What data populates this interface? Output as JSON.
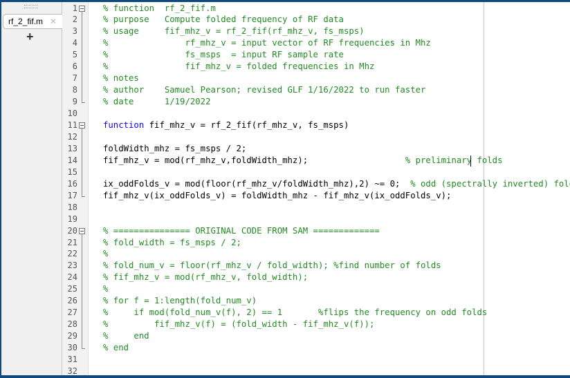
{
  "file_panel": {
    "tabs": [
      {
        "label": "rf_2_fif.m",
        "close_icon": "close-icon"
      }
    ],
    "add_tab_label": "+"
  },
  "editor": {
    "lines": [
      {
        "n": "1",
        "segments": [
          {
            "t": "% function  rf_2_fif.m",
            "c": "cmt"
          }
        ]
      },
      {
        "n": "2",
        "segments": [
          {
            "t": "% purpose   Compute folded frequency of RF data",
            "c": "cmt"
          }
        ]
      },
      {
        "n": "3",
        "segments": [
          {
            "t": "% usage     fif_mhz_v = rf_2_fif(rf_mhz_v, fs_msps)",
            "c": "cmt"
          }
        ]
      },
      {
        "n": "4",
        "segments": [
          {
            "t": "%               rf_mhz_v = input vector of RF frequencies in Mhz",
            "c": "cmt"
          }
        ]
      },
      {
        "n": "5",
        "segments": [
          {
            "t": "%               fs_msps  = input RF sample rate",
            "c": "cmt"
          }
        ]
      },
      {
        "n": "6",
        "segments": [
          {
            "t": "%               fif_mhz_v = folded frequencies in Mhz",
            "c": "cmt"
          }
        ]
      },
      {
        "n": "7",
        "segments": [
          {
            "t": "% notes",
            "c": "cmt"
          }
        ]
      },
      {
        "n": "8",
        "segments": [
          {
            "t": "% author    Samuel Pearson; revised GLF 1/16/2022 to run faster",
            "c": "cmt"
          }
        ]
      },
      {
        "n": "9",
        "segments": [
          {
            "t": "% date      1/19/2022",
            "c": "cmt"
          }
        ]
      },
      {
        "n": "10",
        "segments": []
      },
      {
        "n": "11",
        "segments": [
          {
            "t": "function",
            "c": "kw"
          },
          {
            "t": " fif_mhz_v = rf_2_fif(rf_mhz_v, fs_msps)",
            "c": ""
          }
        ]
      },
      {
        "n": "12",
        "segments": []
      },
      {
        "n": "13",
        "segments": [
          {
            "t": "foldWidth_mhz = fs_msps / 2;",
            "c": ""
          }
        ]
      },
      {
        "n": "14",
        "segments": [
          {
            "t": "fif_mhz_v = mod(rf_mhz_v,foldWidth_mhz);                   ",
            "c": ""
          },
          {
            "t": "% preliminary folds",
            "c": "cmt"
          }
        ]
      },
      {
        "n": "15",
        "segments": []
      },
      {
        "n": "16",
        "segments": [
          {
            "t": "ix_oddFolds_v = mod(floor(rf_mhz_v/foldWidth_mhz),2) ~= 0;  ",
            "c": ""
          },
          {
            "t": "% odd (spectrally inverted) folds",
            "c": "cmt"
          }
        ]
      },
      {
        "n": "17",
        "segments": [
          {
            "t": "fif_mhz_v(ix_oddFolds_v) = foldWidth_mhz - fif_mhz_v(ix_oddFolds_v);",
            "c": ""
          }
        ]
      },
      {
        "n": "18",
        "segments": []
      },
      {
        "n": "19",
        "segments": []
      },
      {
        "n": "20",
        "segments": [
          {
            "t": "% =============== ORIGINAL CODE FROM SAM =============",
            "c": "cmt"
          }
        ]
      },
      {
        "n": "21",
        "segments": [
          {
            "t": "% fold_width = fs_msps / 2;",
            "c": "cmt"
          }
        ]
      },
      {
        "n": "22",
        "segments": [
          {
            "t": "%",
            "c": "cmt"
          }
        ]
      },
      {
        "n": "23",
        "segments": [
          {
            "t": "% fold_num_v = floor(rf_mhz_v / fold_width); %find number of folds",
            "c": "cmt"
          }
        ]
      },
      {
        "n": "24",
        "segments": [
          {
            "t": "% fif_mhz_v = mod(rf_mhz_v, fold_width);",
            "c": "cmt"
          }
        ]
      },
      {
        "n": "25",
        "segments": [
          {
            "t": "%",
            "c": "cmt"
          }
        ]
      },
      {
        "n": "26",
        "segments": [
          {
            "t": "% for f = 1:length(fold_num_v)",
            "c": "cmt"
          }
        ]
      },
      {
        "n": "27",
        "segments": [
          {
            "t": "%     if mod(fold_num_v(f), 2) == 1       %flips the frequency on odd folds",
            "c": "cmt"
          }
        ]
      },
      {
        "n": "28",
        "segments": [
          {
            "t": "%         fif_mhz_v(f) = (fold_width - fif_mhz_v(f));",
            "c": "cmt"
          }
        ]
      },
      {
        "n": "29",
        "segments": [
          {
            "t": "%     end",
            "c": "cmt"
          }
        ]
      },
      {
        "n": "30",
        "segments": [
          {
            "t": "% end",
            "c": "cmt"
          }
        ]
      },
      {
        "n": "31",
        "segments": []
      },
      {
        "n": "32",
        "segments": []
      }
    ],
    "folds": [
      {
        "start": 1,
        "end": 9
      },
      {
        "start": 11,
        "end": 17
      },
      {
        "start": 20,
        "end": 30
      }
    ],
    "colors": {
      "comment": "#228b22",
      "keyword": "#0e00ff",
      "frame": "#0e4a80"
    }
  }
}
